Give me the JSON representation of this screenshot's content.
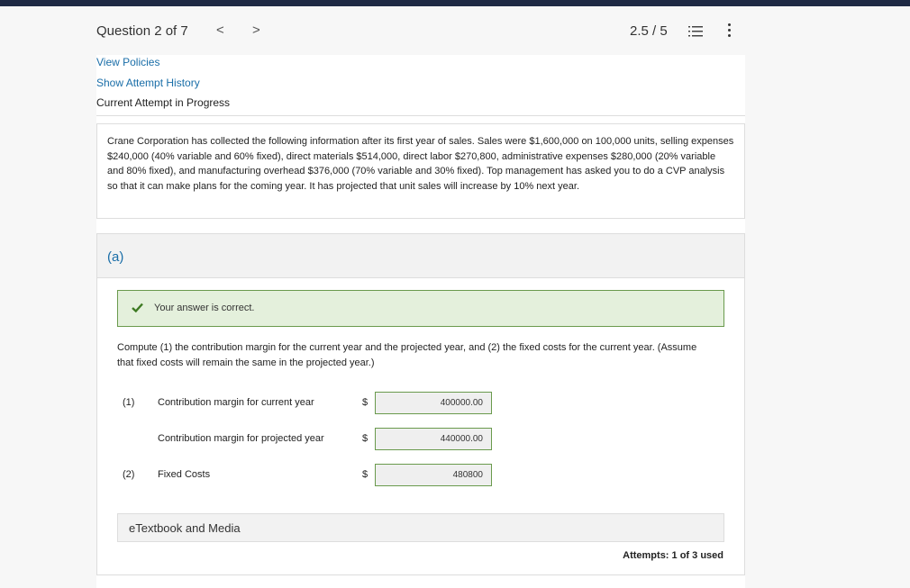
{
  "header": {
    "question_title": "Question 2 of 7",
    "prev_label": "<",
    "next_label": ">",
    "score": "2.5 / 5",
    "list_icon": "list-icon",
    "more_icon": "more-vertical-icon"
  },
  "links": {
    "view_policies": "View Policies",
    "show_attempt_history": "Show Attempt History"
  },
  "attempt_status": "Current Attempt in Progress",
  "problem_text": "Crane Corporation has collected the following information after its first year of sales. Sales were $1,600,000 on 100,000 units, selling expenses $240,000 (40% variable and 60% fixed), direct materials $514,000, direct labor $270,800, administrative expenses $280,000 (20% variable and 80% fixed), and manufacturing overhead $376,000 (70% variable and 30% fixed). Top management has asked you to do a CVP analysis so that it can make plans for the coming year. It has projected that unit sales will increase by 10% next year.",
  "part": {
    "label": "(a)",
    "feedback": "Your answer is correct.",
    "feedback_color": "#6a9a4d",
    "instructions": "Compute (1) the contribution margin for the current year and the projected year, and (2) the fixed costs for the current year. (Assume that fixed costs will remain the same in the projected year.)",
    "rows": [
      {
        "num": "(1)",
        "label": "Contribution margin for current year",
        "currency": "$",
        "value": "400000.00"
      },
      {
        "num": "",
        "label": "Contribution margin for projected year",
        "currency": "$",
        "value": "440000.00"
      },
      {
        "num": "(2)",
        "label": "Fixed Costs",
        "currency": "$",
        "value": "480800"
      }
    ],
    "etextbook": "eTextbook and Media",
    "attempts": "Attempts: 1 of 3 used"
  }
}
